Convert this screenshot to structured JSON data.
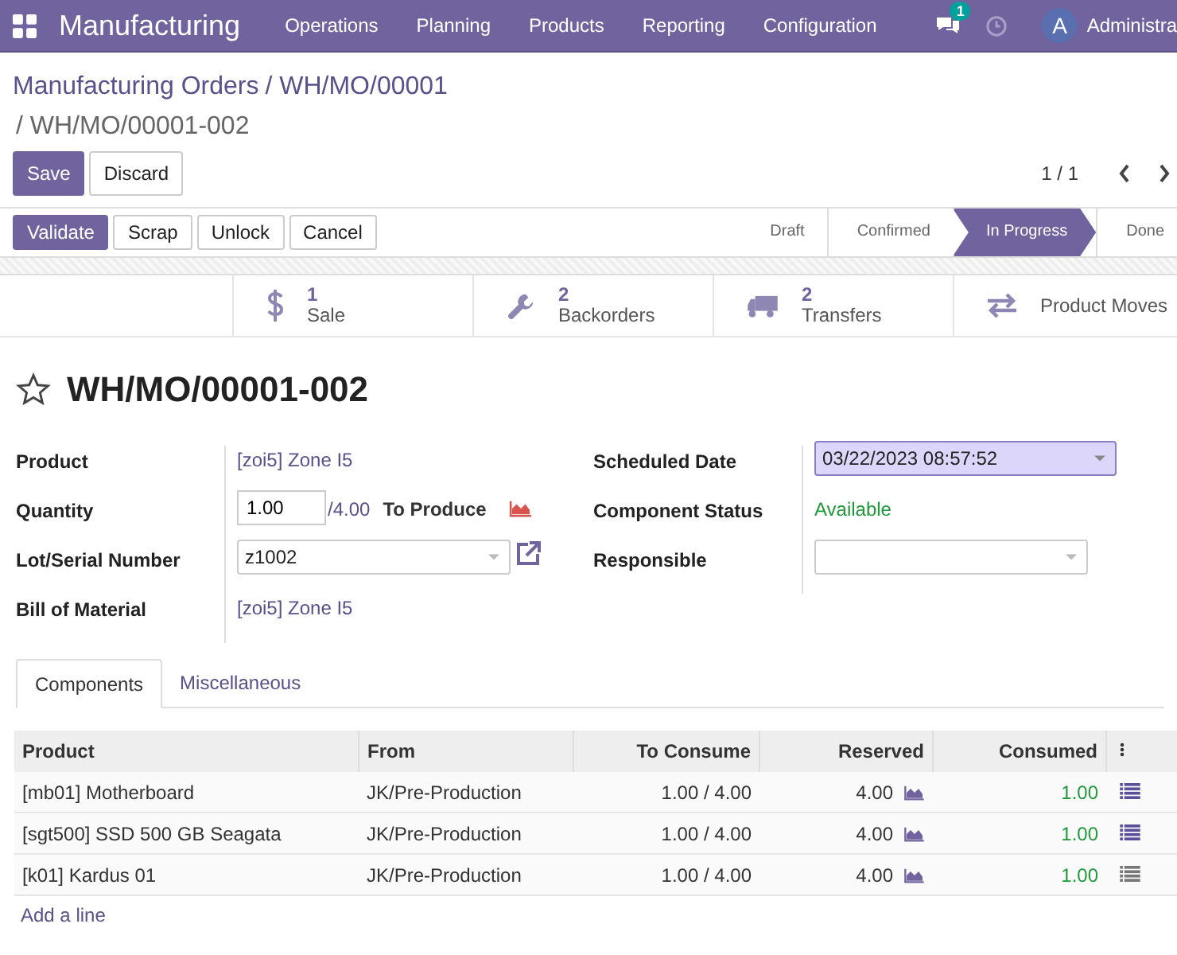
{
  "navbar": {
    "brand": "Manufacturing",
    "menu": [
      "Operations",
      "Planning",
      "Products",
      "Reporting",
      "Configuration"
    ],
    "messages_badge": "1",
    "avatar": "A",
    "user": "Administra"
  },
  "breadcrumbs": [
    {
      "label": "Manufacturing Orders",
      "kind": "link"
    },
    {
      "label": "/ WH/MO/00001",
      "kind": "link"
    },
    {
      "label": "/ WH/MO/00001-002",
      "kind": "current"
    }
  ],
  "form_buttons": [
    {
      "label": "Save",
      "kind": "primary"
    },
    {
      "label": "Discard",
      "kind": "secondary"
    }
  ],
  "pager": "1 / 1",
  "actions": [
    {
      "label": "Validate",
      "kind": "primary"
    },
    {
      "label": "Scrap",
      "kind": "secondary"
    },
    {
      "label": "Unlock",
      "kind": "secondary"
    },
    {
      "label": "Cancel",
      "kind": "secondary"
    }
  ],
  "stages": [
    {
      "label": "Draft",
      "selected": false
    },
    {
      "label": "Confirmed",
      "selected": false
    },
    {
      "label": "In Progress",
      "selected": true
    },
    {
      "label": "Done",
      "selected": false
    }
  ],
  "smart_buttons": [
    {
      "kind": "dollar",
      "count": "1",
      "label": "Sale"
    },
    {
      "kind": "wrench",
      "count": "2",
      "label": "Backorders"
    },
    {
      "kind": "truck",
      "count": "2",
      "label": "Transfers"
    },
    {
      "kind": "arrows",
      "label": "Product Moves"
    }
  ],
  "title": "WH/MO/00001-002",
  "starred": false,
  "left_fields": [
    {
      "label": "Product",
      "kind": "link",
      "value": "[zoi5] Zone I5"
    },
    {
      "label": "Quantity",
      "kind": "quantity",
      "value": "1.00",
      "total": "/4.00",
      "suffix": "To Produce"
    },
    {
      "label": "Lot/Serial Number",
      "kind": "select",
      "value": "z1002"
    },
    {
      "label": "Bill of Material",
      "kind": "link",
      "value": "[zoi5] Zone I5"
    }
  ],
  "right_fields": [
    {
      "label": "Scheduled Date",
      "kind": "date",
      "value": "03/22/2023 08:57:52"
    },
    {
      "label": "Component Status",
      "kind": "status",
      "value": "Available"
    },
    {
      "label": "Responsible",
      "kind": "select"
    }
  ],
  "tabs": [
    {
      "label": "Components",
      "selected": true
    },
    {
      "label": "Miscellaneous",
      "selected": false
    }
  ],
  "table": {
    "columns": [
      "Product",
      "From",
      "To Consume",
      "Reserved",
      "Consumed"
    ],
    "rows": [
      {
        "product": "[mb01] Motherboard",
        "from": "JK/Pre-Production",
        "to_consume": "1.00 / 4.00",
        "reserved": "4.00",
        "consumed": "1.00",
        "details_highlighted": true
      },
      {
        "product": "[sgt500] SSD 500 GB Seagata",
        "from": "JK/Pre-Production",
        "to_consume": "1.00 / 4.00",
        "reserved": "4.00",
        "consumed": "1.00",
        "details_highlighted": true
      },
      {
        "product": "[k01] Kardus 01",
        "from": "JK/Pre-Production",
        "to_consume": "1.00 / 4.00",
        "reserved": "4.00",
        "consumed": "1.00",
        "details_highlighted": false
      }
    ],
    "add_line": "Add a line"
  }
}
